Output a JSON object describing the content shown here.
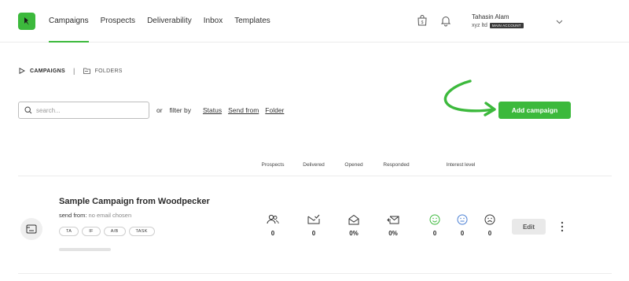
{
  "nav": {
    "items": [
      {
        "label": "Campaigns",
        "active": true
      },
      {
        "label": "Prospects"
      },
      {
        "label": "Deliverability"
      },
      {
        "label": "Inbox"
      },
      {
        "label": "Templates"
      }
    ]
  },
  "user": {
    "name": "Tahasin Alam",
    "org": "xyz ltd",
    "badge": "MAIN ACCOUNT"
  },
  "breadcrumb": {
    "campaigns": "CAMPAIGNS",
    "separator": "|",
    "folders": "FOLDERS"
  },
  "search": {
    "placeholder": "search...",
    "value": ""
  },
  "filter": {
    "or": "or",
    "filter_by": "filter by",
    "links": [
      "Status",
      "Send from",
      "Folder"
    ]
  },
  "add_campaign_label": "Add campaign",
  "table_headers": {
    "prospects": "Prospects",
    "delivered": "Delivered",
    "opened": "Opened",
    "responded": "Responded",
    "interest": "Interest level"
  },
  "campaign": {
    "title": "Sample Campaign from Woodpecker",
    "send_from_label": "send from:",
    "send_from_value": "no email chosen",
    "tags": [
      "TA",
      "IF",
      "A/B",
      "TASK"
    ],
    "progress": 0,
    "stats": {
      "prospects": "0",
      "delivered": "0",
      "opened": "0%",
      "responded": "0%",
      "interest_positive": "0",
      "interest_neutral": "0",
      "interest_negative": "0"
    },
    "edit_label": "Edit"
  },
  "colors": {
    "accent": "#3cb93c",
    "neutral_face": "#4a7fd4",
    "negative_face": "#333333"
  }
}
